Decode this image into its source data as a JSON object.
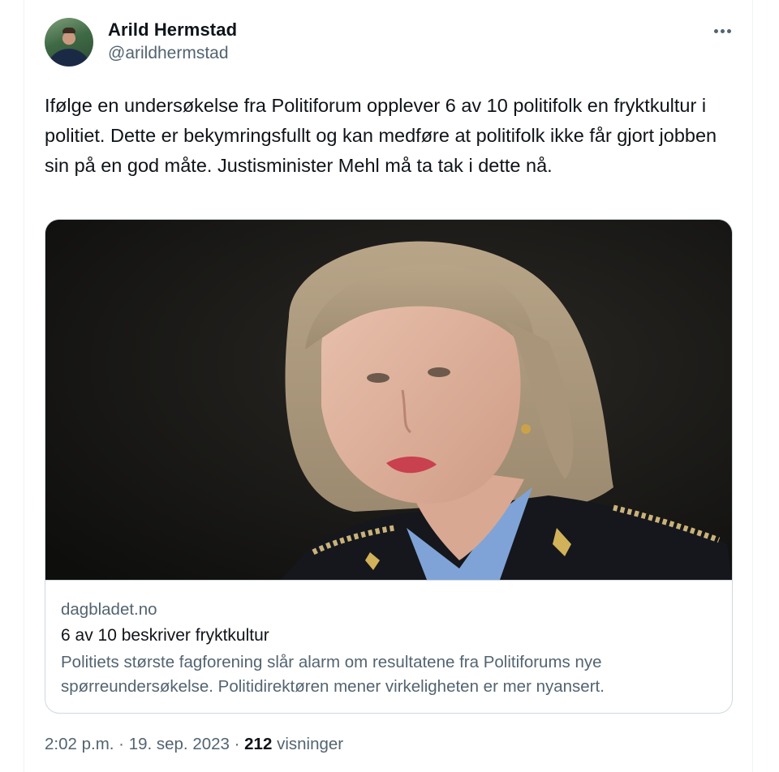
{
  "author": {
    "display_name": "Arild Hermstad",
    "handle": "@arildhermstad",
    "avatar_icon": "profile-photo"
  },
  "more_icon": "ellipsis-icon",
  "tweet": {
    "text": "Ifølge en undersøkelse fra Politiforum opplever 6 av 10 politifolk en fryktkultur i politiet. Dette er bekymringsfullt og kan medføre at politifolk ikke får gjort jobben sin på en god måte. Justisminister Mehl må ta tak i dette nå."
  },
  "link_card": {
    "domain": "dagbladet.no",
    "title": "6 av 10 beskriver fryktkultur",
    "description": "Politiets største fagforening slår alarm om resultatene fra Politiforums nye spørreundersøkelse. Politidirektøren mener virkeligheten er mer nyansert."
  },
  "footer": {
    "time": "2:02 p.m.",
    "sep1": " · ",
    "date": "19. sep. 2023",
    "sep2": " · ",
    "views_count": "212",
    "views_label": " visninger"
  },
  "colors": {
    "text_primary": "#0f1419",
    "text_secondary": "#536471",
    "border": "#cfd9de"
  }
}
